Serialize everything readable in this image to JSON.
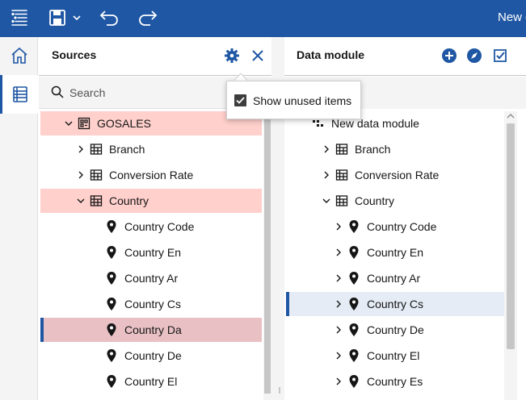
{
  "toolbar": {
    "new_label": "New d"
  },
  "sources": {
    "title": "Sources",
    "search_placeholder": "Search",
    "tree": [
      {
        "label": "GOSALES",
        "icon": "schema-icon",
        "chevron": "down",
        "level": 1,
        "highlight": "pink"
      },
      {
        "label": "Branch",
        "icon": "table-icon",
        "chevron": "right",
        "level": 2,
        "highlight": ""
      },
      {
        "label": "Conversion Rate",
        "icon": "table-icon",
        "chevron": "right",
        "level": 2,
        "highlight": ""
      },
      {
        "label": "Country",
        "icon": "table-icon",
        "chevron": "down",
        "level": 2,
        "highlight": "pink"
      },
      {
        "label": "Country Code",
        "icon": "location-icon",
        "chevron": "",
        "level": 3,
        "highlight": ""
      },
      {
        "label": "Country En",
        "icon": "location-icon",
        "chevron": "",
        "level": 3,
        "highlight": ""
      },
      {
        "label": "Country Ar",
        "icon": "location-icon",
        "chevron": "",
        "level": 3,
        "highlight": ""
      },
      {
        "label": "Country Cs",
        "icon": "location-icon",
        "chevron": "",
        "level": 3,
        "highlight": ""
      },
      {
        "label": "Country Da",
        "icon": "location-icon",
        "chevron": "",
        "level": 3,
        "highlight": "dpink"
      },
      {
        "label": "Country De",
        "icon": "location-icon",
        "chevron": "",
        "level": 3,
        "highlight": ""
      },
      {
        "label": "Country El",
        "icon": "location-icon",
        "chevron": "",
        "level": 3,
        "highlight": ""
      }
    ]
  },
  "popover": {
    "show_unused_label": "Show unused items",
    "checked": true
  },
  "data_module": {
    "title": "Data module",
    "tree": [
      {
        "label": "New data module",
        "icon": "module-icon",
        "chevron": "",
        "level": 1,
        "highlight": ""
      },
      {
        "label": "Branch",
        "icon": "table-icon",
        "chevron": "right",
        "level": 2,
        "highlight": ""
      },
      {
        "label": "Conversion Rate",
        "icon": "table-icon",
        "chevron": "right",
        "level": 2,
        "highlight": ""
      },
      {
        "label": "Country",
        "icon": "table-icon",
        "chevron": "down",
        "level": 2,
        "highlight": ""
      },
      {
        "label": "Country Code",
        "icon": "location-icon",
        "chevron": "right",
        "level": 3,
        "highlight": ""
      },
      {
        "label": "Country En",
        "icon": "location-icon",
        "chevron": "right",
        "level": 3,
        "highlight": ""
      },
      {
        "label": "Country Ar",
        "icon": "location-icon",
        "chevron": "right",
        "level": 3,
        "highlight": ""
      },
      {
        "label": "Country Cs",
        "icon": "location-icon",
        "chevron": "right",
        "level": 3,
        "highlight": "blue"
      },
      {
        "label": "Country De",
        "icon": "location-icon",
        "chevron": "right",
        "level": 3,
        "highlight": ""
      },
      {
        "label": "Country El",
        "icon": "location-icon",
        "chevron": "right",
        "level": 3,
        "highlight": ""
      },
      {
        "label": "Country Es",
        "icon": "location-icon",
        "chevron": "right",
        "level": 3,
        "highlight": ""
      }
    ]
  },
  "colors": {
    "brand": "#1f57a4",
    "highlight_pink": "#ffd0cc",
    "highlight_dark_pink": "#e9c1c5",
    "highlight_blue": "#e5ecf5"
  }
}
